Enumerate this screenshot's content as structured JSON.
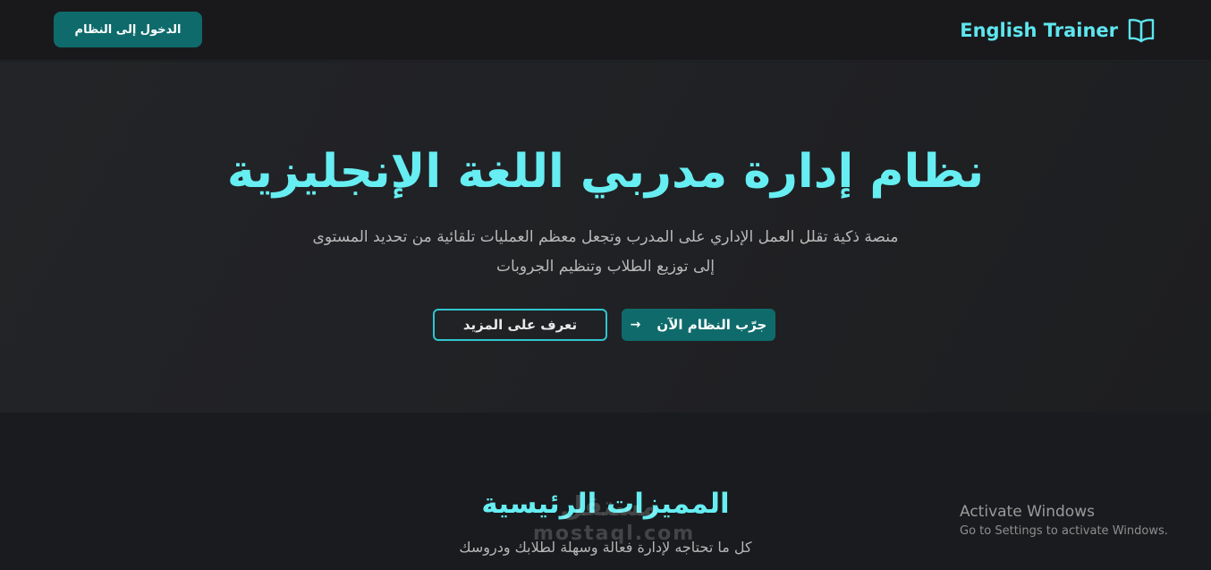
{
  "header": {
    "brand": "English Trainer",
    "brand_icon": "book-open-icon",
    "login_label": "الدخول إلى النظام"
  },
  "hero": {
    "title": "نظام إدارة مدربي اللغة الإنجليزية",
    "description": "منصة ذكية تقلل العمل الإداري على المدرب وتجعل معظم العمليات تلقائية من تحديد المستوى إلى توزيع الطلاب وتنظيم الجروبات",
    "try_label": "جرّب النظام الآن",
    "try_icon": "arrow-right-icon",
    "more_label": "تعرف على المزيد"
  },
  "features": {
    "title": "المميزات الرئيسية",
    "subtitle": "كل ما تحتاجه لإدارة فعالة وسهلة لطلابك ودروسك"
  },
  "watermark": {
    "arabic": "مستقل",
    "latin": "mostaql.com"
  },
  "os_overlay": {
    "title": "Activate Windows",
    "subtitle": "Go to Settings to activate Windows."
  },
  "colors": {
    "accent": "#66eef2",
    "button": "#0f6b6b",
    "outline": "#2fc6cf",
    "background": "#1b1c1f"
  }
}
